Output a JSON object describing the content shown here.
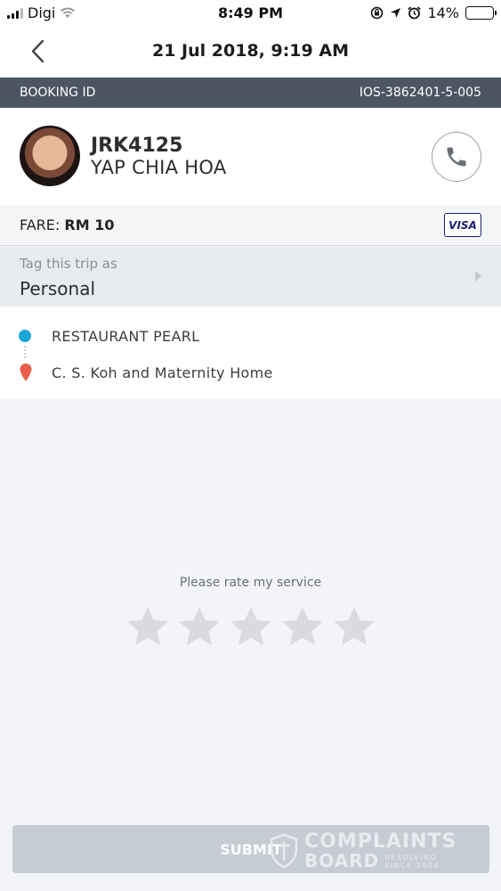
{
  "status_bar": {
    "carrier": "Digi",
    "time": "8:49 PM",
    "battery": "14%",
    "battery_level": 0.14,
    "icons": [
      "signal-icon",
      "wifi-icon",
      "screen-rotation-lock-icon",
      "location-arrow-icon",
      "alarm-icon",
      "battery-icon"
    ]
  },
  "nav": {
    "title": "21 Jul 2018, 9:19 AM",
    "back_icon": "chevron-left-icon"
  },
  "booking": {
    "label": "BOOKING ID",
    "id": "IOS-3862401-5-005"
  },
  "driver": {
    "plate": "JRK4125",
    "name": "YAP CHIA HOA",
    "call_icon": "phone-icon"
  },
  "fare": {
    "label": "FARE:",
    "amount": "RM 10",
    "payment_badge": "VISA"
  },
  "tag": {
    "label": "Tag this trip as",
    "value": "Personal"
  },
  "route": {
    "pickup": "RESTAURANT PEARL",
    "dropoff": "C. S. Koh and Maternity Home"
  },
  "rating": {
    "prompt": "Please rate my service",
    "max_stars": 5,
    "selected": 0
  },
  "submit": {
    "label": "SUBMIT"
  },
  "watermark": {
    "line1": "COMPLAINTS",
    "line2": "BOARD",
    "tagline1": "RESOLVING",
    "tagline2": "SINCE 2004"
  },
  "colors": {
    "header_bar": "#4b5563",
    "pickup_dot": "#1aa6d9",
    "dropoff_pin": "#e8604c",
    "star_empty": "#d9dbde",
    "battery_fill": "#f5c518"
  }
}
